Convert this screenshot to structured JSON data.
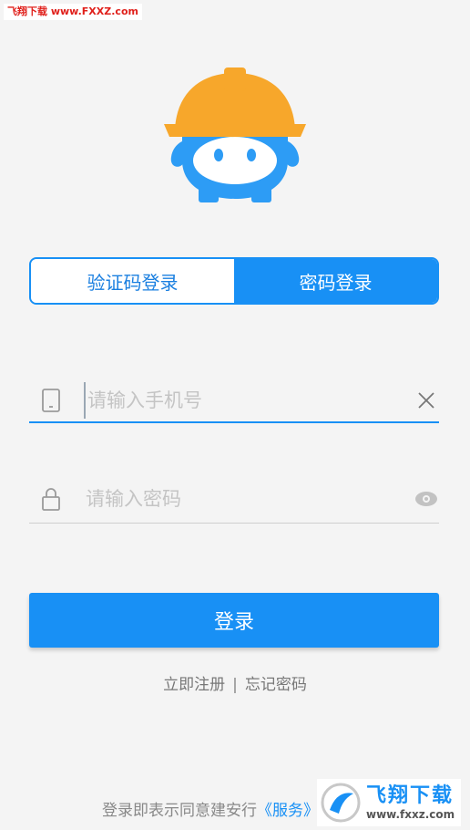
{
  "watermark_top": "飞翔下载 www.FXXZ.com",
  "tabs": [
    {
      "label": "验证码登录",
      "active": false
    },
    {
      "label": "密码登录",
      "active": true
    }
  ],
  "phone_field": {
    "placeholder": "请输入手机号",
    "value": ""
  },
  "password_field": {
    "placeholder": "请输入密码",
    "value": ""
  },
  "login_button": "登录",
  "links": {
    "register": "立即注册",
    "separator": "|",
    "forgot": "忘记密码"
  },
  "agreement": {
    "text": "登录即表示同意建安行",
    "service": "《服务》"
  },
  "watermark_bottom": {
    "title": "飞翔下载",
    "url": "www.fxxz.com"
  },
  "colors": {
    "accent": "#1890f5",
    "helmet": "#f7a72b",
    "background": "#f4f4f4"
  },
  "icons": [
    "helmet-logo",
    "phone-icon",
    "clear-icon",
    "lock-icon",
    "eye-icon"
  ]
}
